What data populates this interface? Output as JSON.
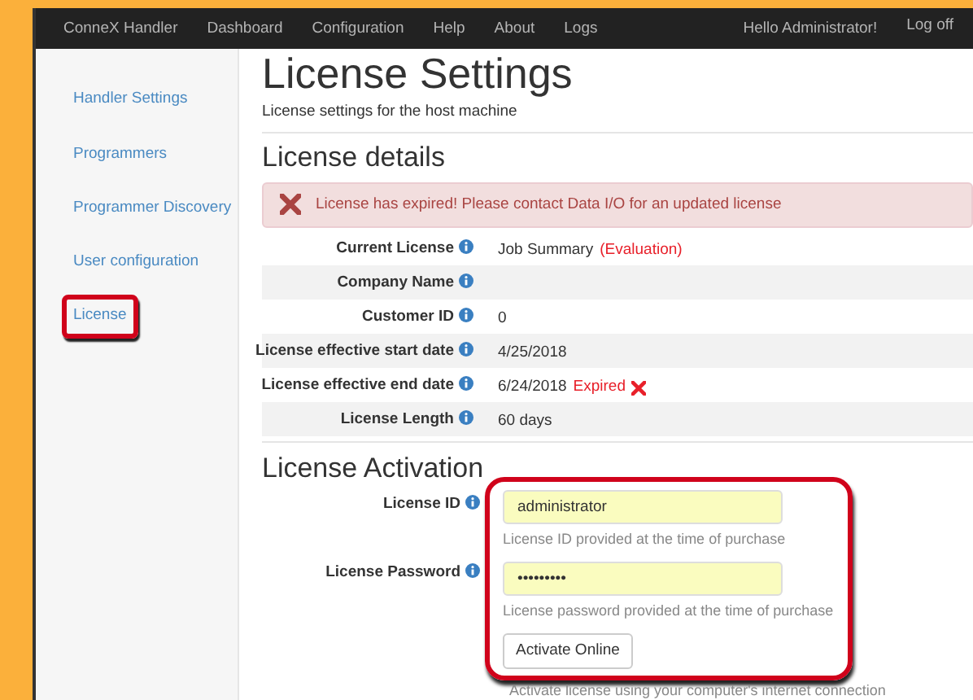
{
  "navbar": {
    "brand": "ConneX Handler",
    "links": [
      "Dashboard",
      "Configuration",
      "Help",
      "About",
      "Logs"
    ],
    "greeting": "Hello Administrator!",
    "logoff": "Log off"
  },
  "sidebar": {
    "items": [
      {
        "label": "Handler Settings",
        "highlighted": false
      },
      {
        "label": "Programmers",
        "highlighted": false
      },
      {
        "label": "Programmer Discovery",
        "highlighted": false
      },
      {
        "label": "User configuration",
        "highlighted": false
      },
      {
        "label": "License",
        "highlighted": true
      }
    ]
  },
  "page": {
    "title": "License Settings",
    "subtitle": "License settings for the host machine"
  },
  "details": {
    "heading": "License details",
    "alert": "License has expired! Please contact Data I/O for an updated license",
    "rows": [
      {
        "label": "Current License",
        "value": "Job Summary",
        "note": "(Evaluation)",
        "expired": false
      },
      {
        "label": "Company Name",
        "expired": false
      },
      {
        "label": "Customer ID",
        "value": "0",
        "expired": false
      },
      {
        "label": "License effective start date",
        "value": "4/25/2018",
        "expired": false
      },
      {
        "label": "License effective end date",
        "value": "6/24/2018",
        "note": "Expired",
        "expired": true
      },
      {
        "label": "License Length",
        "value": "60 days",
        "expired": false
      }
    ]
  },
  "activation": {
    "heading": "License Activation",
    "highlighted": true,
    "fields": [
      {
        "label": "License ID",
        "kind": "text",
        "value": "administrator",
        "help": "License ID provided at the time of purchase"
      },
      {
        "label": "License Password",
        "kind": "password",
        "value": "•••••••••",
        "help": "License password provided at the time of purchase"
      }
    ],
    "button": "Activate Online",
    "button_help": "Activate license using your computer's internet connection"
  }
}
